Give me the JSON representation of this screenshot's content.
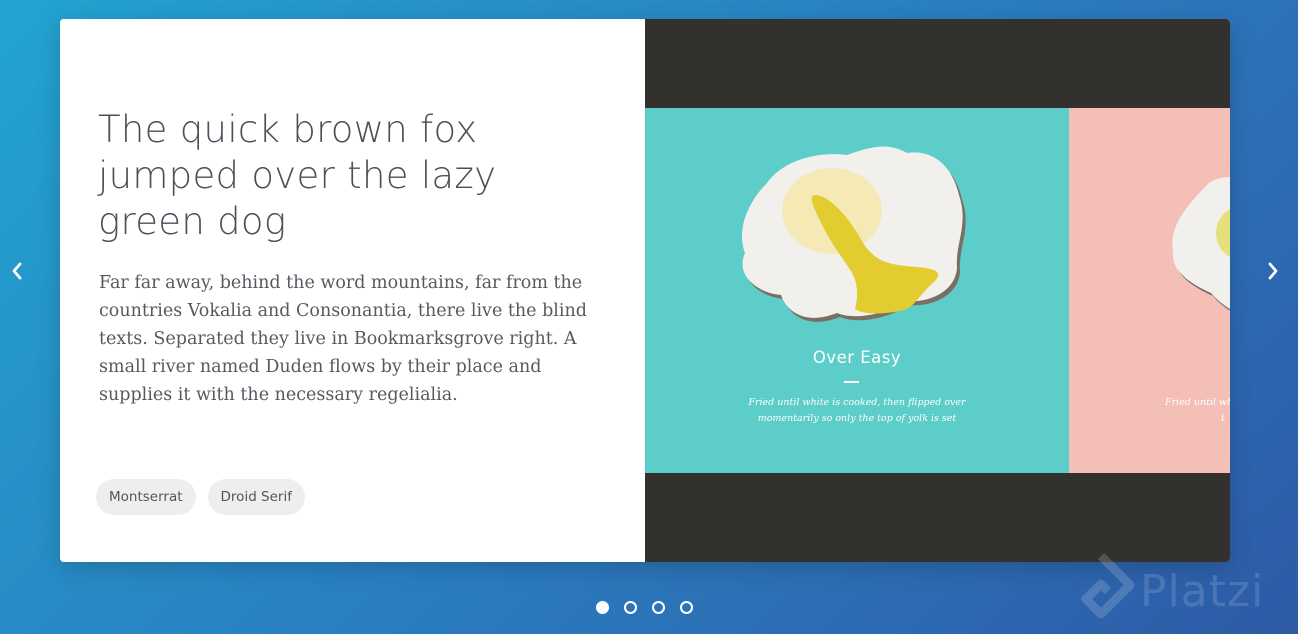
{
  "slide": {
    "headline": "The quick brown fox jumped over the lazy green dog",
    "body": "Far far away, behind the word mountains, far from the countries Vokalia and Consonantia, there live the blind texts. Separated they live in Bookmarksgrove right. A small river named Duden flows by their place and supplies it with the necessary regelialia.",
    "tags": [
      "Montserrat",
      "Droid Serif"
    ]
  },
  "preview": {
    "card1": {
      "title": "Over Easy",
      "line1": "Fried until white is cooked, then flipped over",
      "line2": "momentarily so only the top of yolk is set"
    },
    "card2": {
      "line1": "Fried until wh",
      "line2": "t"
    }
  },
  "navigation": {
    "prev_icon": "chevron-left-icon",
    "next_icon": "chevron-right-icon",
    "dots_count": 4,
    "active_dot": 0
  },
  "watermark": {
    "text": "Platzi"
  },
  "colors": {
    "teal": "#5ccdc8",
    "pink": "#f4bfb7",
    "dark": "#33312e",
    "yolk": "#e2cc2f"
  }
}
